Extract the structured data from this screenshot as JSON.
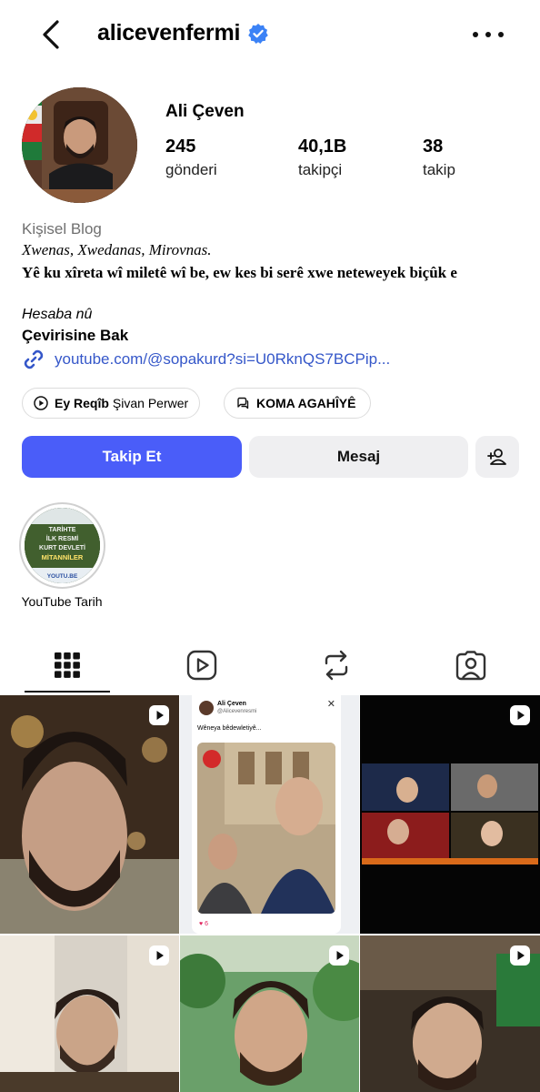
{
  "header": {
    "username": "alicevenfermi",
    "verified": true,
    "back_icon": "chevron-left-icon",
    "more_icon": "more-horizontal-icon"
  },
  "profile": {
    "display_name": "Ali Çeven",
    "stats": [
      {
        "value": "245",
        "label": "gönderi"
      },
      {
        "value": "40,1B",
        "label": "takipçi"
      },
      {
        "value": "38",
        "label": "takip"
      }
    ],
    "category": "Kişisel Blog",
    "bio_line1": "Xwenas, Xwedanas, Mirovnas.",
    "bio_line2": "Yê ku xîreta wî miletê wî be, ew kes bi serê xwe neteweyek biçûk e",
    "bio_line3": "Hesaba nû",
    "translate_label": "Çevirisine Bak",
    "link_text": "youtube.com/@sopakurd?si=U0RknQS7BCPip..."
  },
  "chips": [
    {
      "bold": "Ey Reqîb",
      "rest": "Şivan Perwer",
      "icon": "play-icon"
    },
    {
      "bold": "KOMA AGAHÎYÊ",
      "rest": "",
      "icon": "threads-icon"
    }
  ],
  "actions": {
    "follow_label": "Takip Et",
    "message_label": "Mesaj",
    "add_person_icon": "add-person-icon"
  },
  "highlights": [
    {
      "label": "YouTube Tarih",
      "cover_lines": [
        "TARİHTE",
        "İLK RESMİ",
        "KURT DEVLETİ",
        "MİTANNİLER"
      ],
      "cover_footer": "YOUTU.BE"
    }
  ],
  "tabs": [
    {
      "icon": "grid-icon",
      "active": true
    },
    {
      "icon": "reels-icon",
      "active": false
    },
    {
      "icon": "repost-icon",
      "active": false
    },
    {
      "icon": "tagged-icon",
      "active": false
    }
  ],
  "post_card": {
    "name": "Ali Çeven",
    "handle": "@Alicevenresmi",
    "text": "Wêneya bêdewletiyê...",
    "likes": "6"
  },
  "colors": {
    "accent": "#4a5df9",
    "link": "#3557c9",
    "verified": "#3b82f6"
  }
}
